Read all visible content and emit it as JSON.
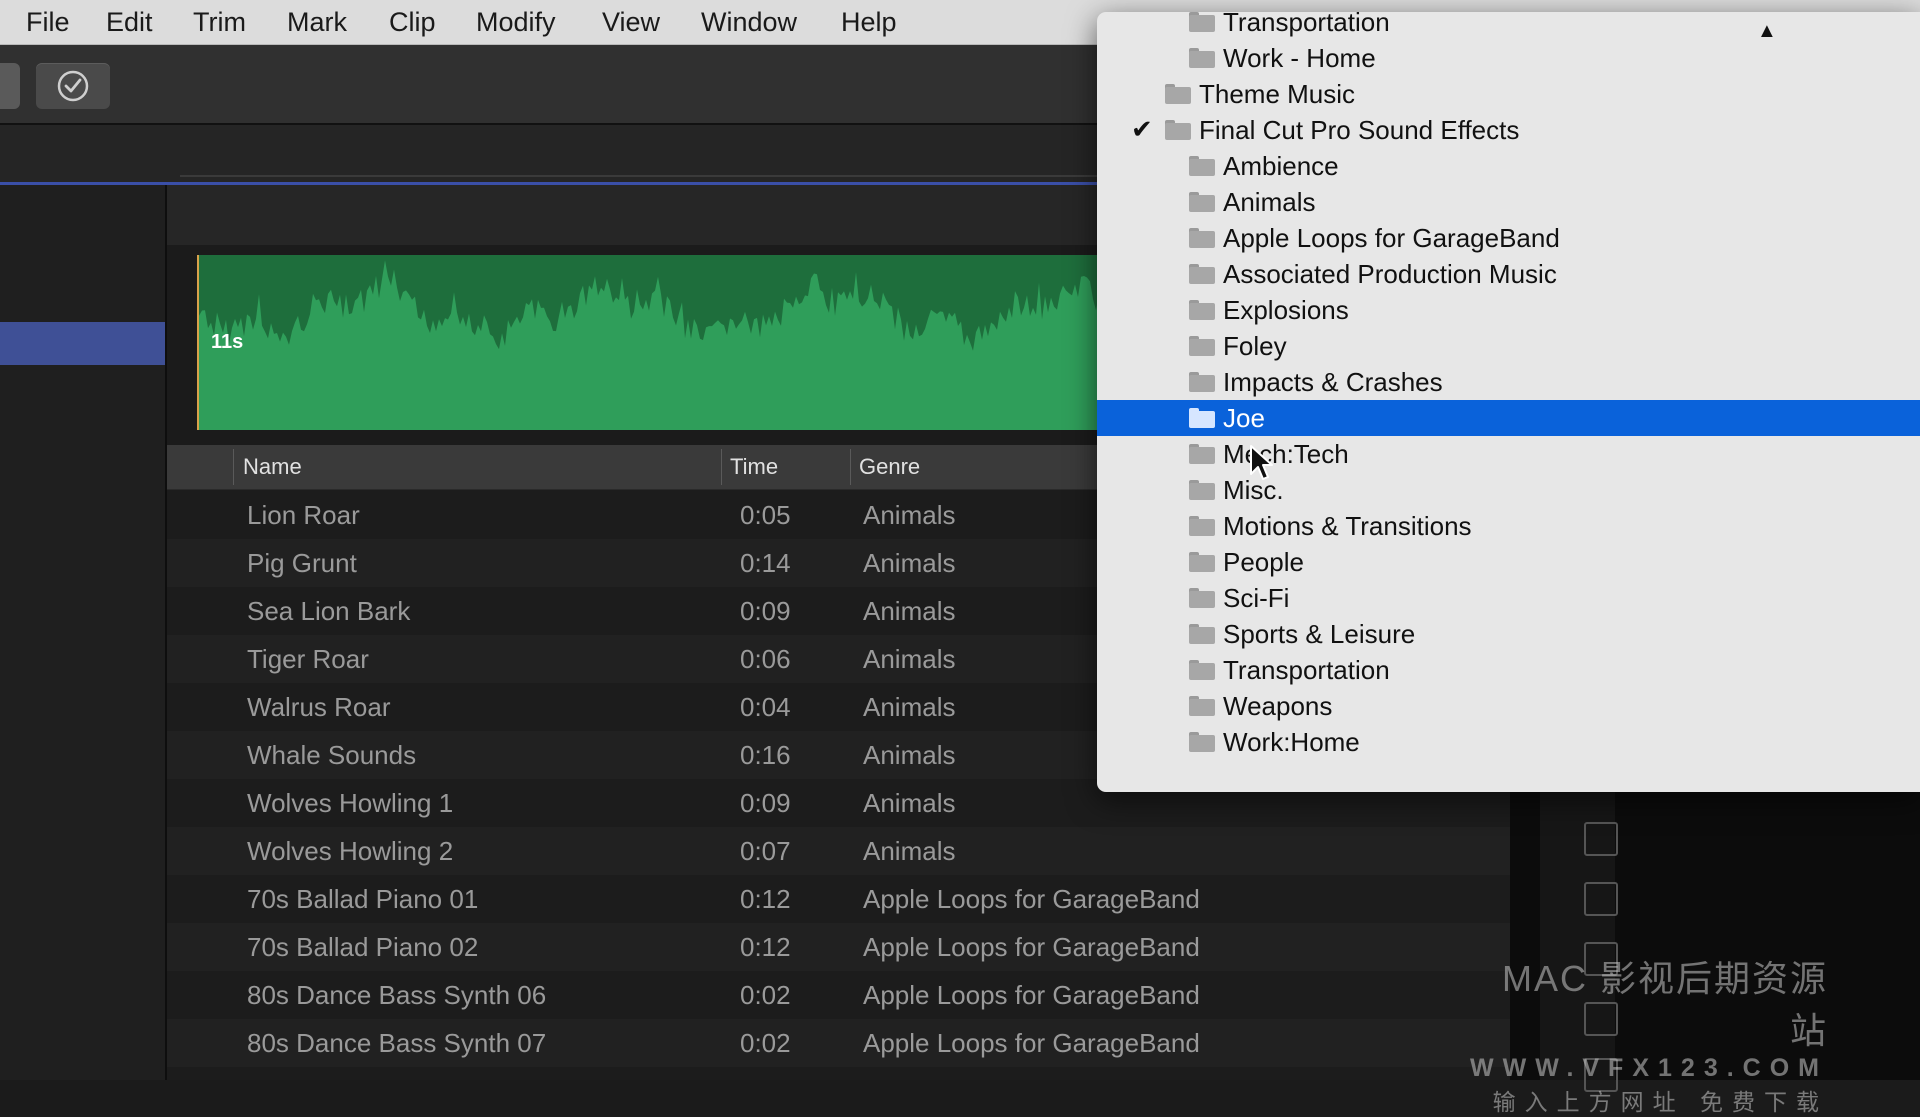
{
  "menubar": {
    "items": [
      "File",
      "Edit",
      "Trim",
      "Mark",
      "Clip",
      "Modify",
      "View",
      "Window",
      "Help"
    ]
  },
  "toolbar": {
    "check_icon": "checkmark-circle-icon"
  },
  "waveform": {
    "duration_label": "11s",
    "color": "#2f9e5a",
    "playhead_color": "#d9a24a"
  },
  "table": {
    "columns": [
      "Name",
      "Time",
      "Genre"
    ],
    "rows": [
      {
        "name": "Lion Roar",
        "time": "0:05",
        "genre": "Animals"
      },
      {
        "name": "Pig Grunt",
        "time": "0:14",
        "genre": "Animals"
      },
      {
        "name": "Sea Lion Bark",
        "time": "0:09",
        "genre": "Animals"
      },
      {
        "name": "Tiger Roar",
        "time": "0:06",
        "genre": "Animals"
      },
      {
        "name": "Walrus Roar",
        "time": "0:04",
        "genre": "Animals"
      },
      {
        "name": "Whale Sounds",
        "time": "0:16",
        "genre": "Animals"
      },
      {
        "name": "Wolves Howling 1",
        "time": "0:09",
        "genre": "Animals"
      },
      {
        "name": "Wolves Howling 2",
        "time": "0:07",
        "genre": "Animals"
      },
      {
        "name": "70s Ballad Piano 01",
        "time": "0:12",
        "genre": "Apple Loops for GarageBand"
      },
      {
        "name": "70s Ballad Piano 02",
        "time": "0:12",
        "genre": "Apple Loops for GarageBand"
      },
      {
        "name": "80s Dance Bass Synth 06",
        "time": "0:02",
        "genre": "Apple Loops for GarageBand"
      },
      {
        "name": "80s Dance Bass Synth 07",
        "time": "0:02",
        "genre": "Apple Loops for GarageBand"
      }
    ]
  },
  "dropdown": {
    "scroll_indicator": "▲",
    "selected_accent": "#0a62da",
    "items": [
      {
        "label": "Transportation",
        "level": 2,
        "checked": false,
        "selected": false
      },
      {
        "label": "Work - Home",
        "level": 2,
        "checked": false,
        "selected": false
      },
      {
        "label": "Theme Music",
        "level": 1,
        "checked": false,
        "selected": false
      },
      {
        "label": "Final Cut Pro Sound Effects",
        "level": 1,
        "checked": true,
        "selected": false
      },
      {
        "label": "Ambience",
        "level": 2,
        "checked": false,
        "selected": false
      },
      {
        "label": "Animals",
        "level": 2,
        "checked": false,
        "selected": false
      },
      {
        "label": "Apple Loops for GarageBand",
        "level": 2,
        "checked": false,
        "selected": false
      },
      {
        "label": "Associated Production Music",
        "level": 2,
        "checked": false,
        "selected": false
      },
      {
        "label": "Explosions",
        "level": 2,
        "checked": false,
        "selected": false
      },
      {
        "label": "Foley",
        "level": 2,
        "checked": false,
        "selected": false
      },
      {
        "label": "Impacts & Crashes",
        "level": 2,
        "checked": false,
        "selected": false
      },
      {
        "label": "Joe",
        "level": 2,
        "checked": false,
        "selected": true
      },
      {
        "label": "Mech:Tech",
        "level": 2,
        "checked": false,
        "selected": false
      },
      {
        "label": "Misc.",
        "level": 2,
        "checked": false,
        "selected": false
      },
      {
        "label": "Motions & Transitions",
        "level": 2,
        "checked": false,
        "selected": false
      },
      {
        "label": "People",
        "level": 2,
        "checked": false,
        "selected": false
      },
      {
        "label": "Sci-Fi",
        "level": 2,
        "checked": false,
        "selected": false
      },
      {
        "label": "Sports & Leisure",
        "level": 2,
        "checked": false,
        "selected": false
      },
      {
        "label": "Transportation",
        "level": 2,
        "checked": false,
        "selected": false
      },
      {
        "label": "Weapons",
        "level": 2,
        "checked": false,
        "selected": false
      },
      {
        "label": "Work:Home",
        "level": 2,
        "checked": false,
        "selected": false
      }
    ]
  },
  "watermark": {
    "line1": "MAC 影视后期资源站",
    "line2": "WWW.VFX123.COM",
    "line3": "输入上方网址 免费下载"
  }
}
